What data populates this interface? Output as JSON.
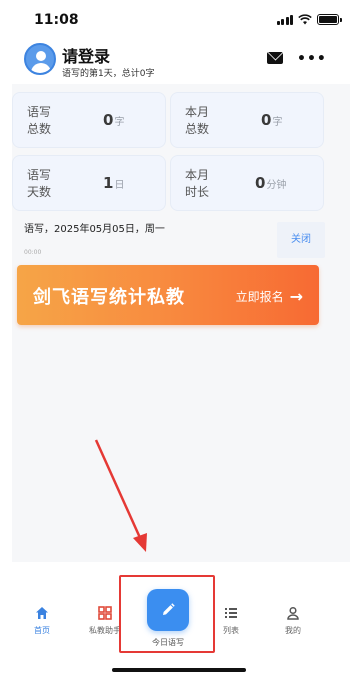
{
  "status_bar": {
    "time": "11:08"
  },
  "header": {
    "title": "请登录",
    "subtitle": "语写的第1天，总计0字",
    "mail_icon": "mail-icon",
    "more_icon": "more-icon"
  },
  "stats": [
    {
      "label": "语写\n总数",
      "value": "0",
      "unit": "字"
    },
    {
      "label": "本月\n总数",
      "value": "0",
      "unit": "字"
    },
    {
      "label": "语写\n天数",
      "value": "1",
      "unit": "日"
    },
    {
      "label": "本月\n时长",
      "value": "0",
      "unit": "分钟"
    }
  ],
  "date_line": "语写，2025年05月05日，周一",
  "time_small": "00:00",
  "close_label": "关闭",
  "banner": {
    "title": "剑飞语写统计私教",
    "cta": "立即报名",
    "cta_icon": "arrow-right-icon",
    "colors": [
      "#f6a547",
      "#f76a33"
    ]
  },
  "tabbar": {
    "items": [
      {
        "label": "首页",
        "icon": "home-icon",
        "active": true
      },
      {
        "label": "私教助手",
        "icon": "apps-icon",
        "active": false
      },
      {
        "label": "今日语写",
        "icon": "pencil-icon",
        "active": false
      },
      {
        "label": "列表",
        "icon": "list-icon",
        "active": false
      },
      {
        "label": "我的",
        "icon": "user-icon",
        "active": false
      }
    ]
  },
  "accent_color": "#3b8ef0",
  "annotation_color": "#e53935"
}
